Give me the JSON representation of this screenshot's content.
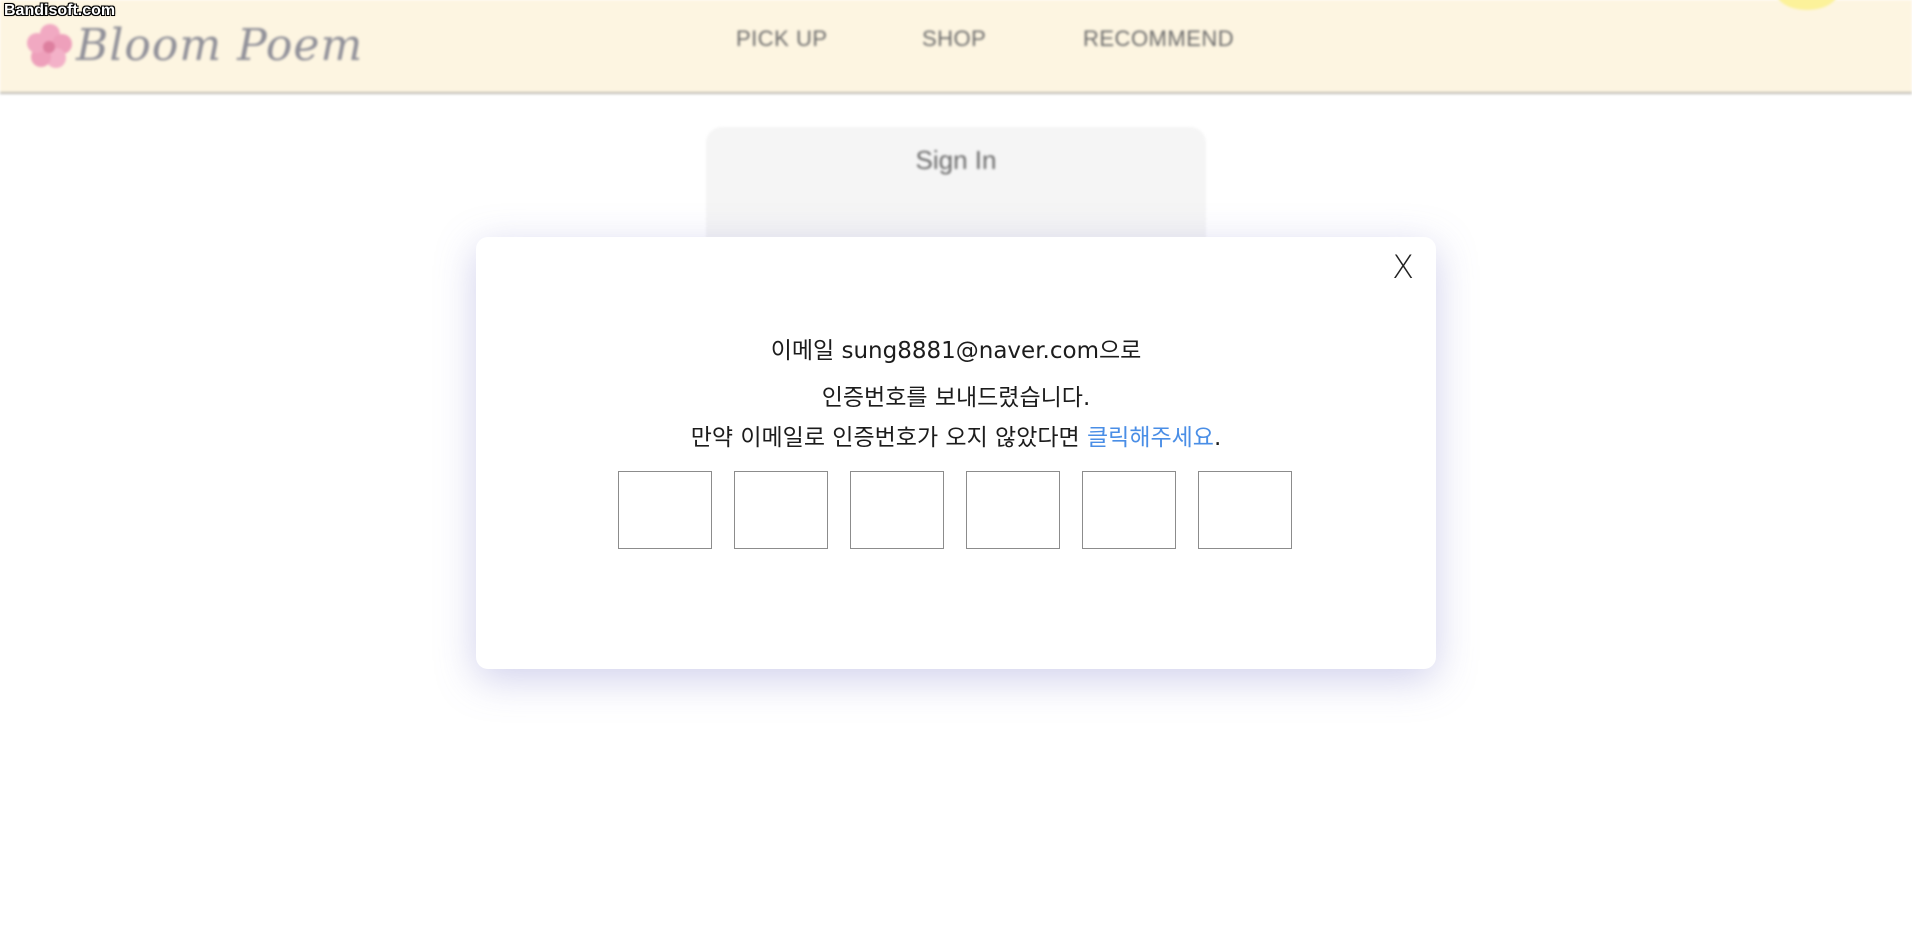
{
  "watermark": "Bandisoft.com",
  "header": {
    "logo_text": "Bloom Poem",
    "nav": [
      "PICK UP",
      "SHOP",
      "RECOMMEND"
    ]
  },
  "signin": {
    "title": "Sign In"
  },
  "modal": {
    "close_label": "X",
    "line1": "이메일 sung8881@naver.com으로",
    "line2": "인증번호를 보내드렸습니다.",
    "line3_prefix": "만약 이메일로 인증번호가 오지 않았다면 ",
    "line3_link": "클릭해주세요",
    "line3_suffix": ".",
    "code_values": [
      "",
      "",
      "",
      "",
      "",
      ""
    ]
  },
  "colors": {
    "header_bg": "#fdf5e1",
    "link": "#4a8ee6",
    "modal_shadow": "#7878c8"
  }
}
